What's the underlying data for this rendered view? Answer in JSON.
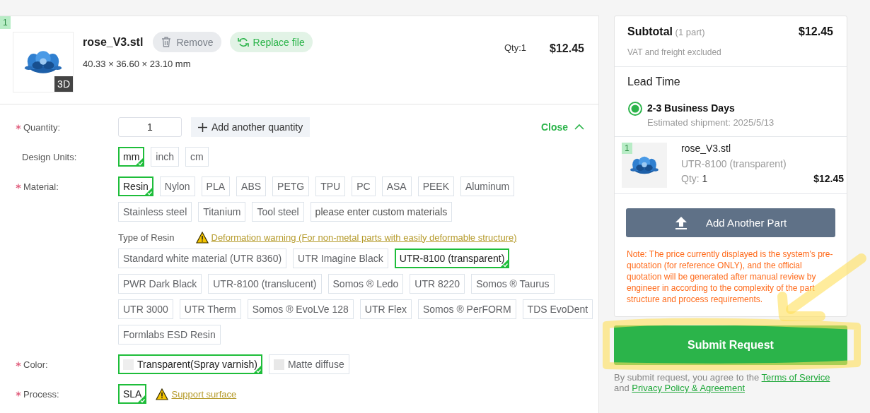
{
  "part": {
    "index": "1",
    "name": "rose_V3.stl",
    "dimensions": "40.33 × 36.60 × 23.10 mm",
    "badge": "3D",
    "remove": "Remove",
    "replace": "Replace file",
    "qty": "Qty:1",
    "price": "$12.45"
  },
  "form": {
    "collapse": "Close",
    "rows": [
      {
        "kind": "quantity",
        "label": "Quantity:",
        "required": true,
        "value": "1",
        "add": "Add another quantity"
      },
      {
        "kind": "chips",
        "label": "Design Units:",
        "required": false,
        "lines": [
          [
            {
              "label": "mm",
              "selected": true
            },
            {
              "label": "inch",
              "selected": false
            },
            {
              "label": "cm",
              "selected": false
            }
          ]
        ]
      },
      {
        "kind": "chips",
        "label": "Material:",
        "required": true,
        "lines": [
          [
            {
              "label": "Resin",
              "selected": true
            },
            {
              "label": "Nylon",
              "selected": false
            },
            {
              "label": "PLA",
              "selected": false
            },
            {
              "label": "ABS",
              "selected": false
            },
            {
              "label": "PETG",
              "selected": false
            },
            {
              "label": "TPU",
              "selected": false
            },
            {
              "label": "PC",
              "selected": false
            },
            {
              "label": "ASA",
              "selected": false
            },
            {
              "label": "PEEK",
              "selected": false
            },
            {
              "label": "Aluminum",
              "selected": false
            }
          ],
          [
            {
              "label": "Stainless steel",
              "selected": false
            },
            {
              "label": "Titanium",
              "selected": false
            },
            {
              "label": "Tool steel",
              "selected": false
            }
          ]
        ],
        "custom_placeholder": "please enter custom materials"
      },
      {
        "kind": "subgroup",
        "label": "Type of Resin",
        "warning": "Deformation warning (For non-metal parts with easily deformable structure)",
        "lines": [
          [
            {
              "label": "Standard white material (UTR 8360)",
              "selected": false
            },
            {
              "label": "UTR Imagine Black",
              "selected": false
            },
            {
              "label": "UTR-8100 (transparent)",
              "selected": true
            }
          ],
          [
            {
              "label": "PWR Dark Black",
              "selected": false
            },
            {
              "label": "UTR-8100 (translucent)",
              "selected": false
            },
            {
              "label": "Somos ® Ledo",
              "selected": false
            },
            {
              "label": "UTR 8220",
              "selected": false
            },
            {
              "label": "Somos ® Taurus",
              "selected": false
            }
          ],
          [
            {
              "label": "UTR 3000",
              "selected": false
            },
            {
              "label": "UTR Therm",
              "selected": false
            },
            {
              "label": "Somos ® EvoLVe 128",
              "selected": false
            },
            {
              "label": "UTR Flex",
              "selected": false
            },
            {
              "label": "Somos ® PerFORM",
              "selected": false
            },
            {
              "label": "TDS EvoDent",
              "selected": false
            }
          ],
          [
            {
              "label": "Formlabs ESD Resin",
              "selected": false
            }
          ]
        ]
      },
      {
        "kind": "swatches",
        "label": "Color:",
        "required": true,
        "lines": [
          [
            {
              "label": "Transparent(Spray varnish)",
              "selected": true,
              "color": "#eeeeee"
            },
            {
              "label": "Matte diffuse",
              "selected": false,
              "color": "#e8e8e8"
            }
          ]
        ]
      },
      {
        "kind": "chips",
        "label": "Process:",
        "required": true,
        "lines": [
          [
            {
              "label": "SLA",
              "selected": true
            }
          ]
        ],
        "warning": "Support surface"
      }
    ]
  },
  "summary": {
    "title": "Subtotal",
    "count": "(1 part)",
    "total": "$12.45",
    "note": "VAT and freight excluded",
    "lead_title": "Lead Time",
    "lead_options": [
      {
        "label": "2-3 Business Days",
        "detail": "Estimated shipment: 2025/5/13",
        "selected": true
      }
    ],
    "parts": [
      {
        "index": "1",
        "name": "rose_V3.stl",
        "material": "UTR-8100 (transparent)",
        "qty_label": "Qty:",
        "qty": "1",
        "price": "$12.45"
      }
    ],
    "add_part": "Add Another Part",
    "disclaimer": "Note: The price currently displayed is the system's pre-quotation (for reference ONLY), and the official quotation will be generated after manual review by engineer in according to the complexity of the part structure and process requirements."
  },
  "submit": "Submit Request",
  "agreement": {
    "text": "By submit request, you agree to the",
    "terms": "Terms of Service",
    "joiner": "and",
    "privacy": "Privacy Policy & Agreement"
  },
  "annotation": {
    "kind": "highlighter"
  }
}
